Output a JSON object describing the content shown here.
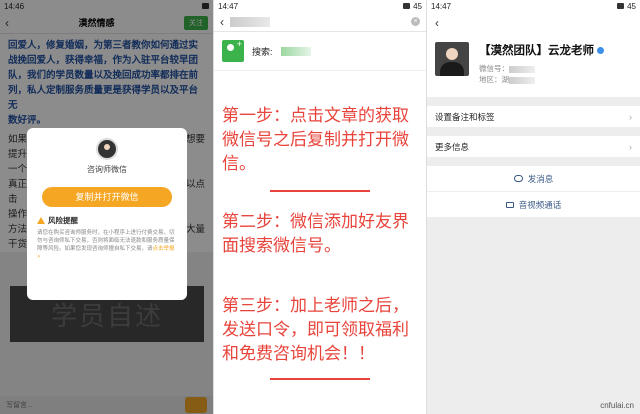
{
  "panel1": {
    "status_time": "14:46",
    "header_title": "漠然情感",
    "follow_label": "关注",
    "article_lines_blue": [
      "回爱人，修复婚姻，为第三者教你如何通过实",
      "战挽回爱人，获得幸福，作为入驻平台较早团",
      "队，我们的学员数量以及挽回成功率都排在前",
      "列，私人定制服务质量更是获得学员以及平台无",
      "数好评。"
    ],
    "article_lines_black": [
      "如果",
      "想要",
      "提升",
      "一个",
      "真正",
      "以点",
      "击",
      "操作",
      "方法",
      "大量",
      "干货"
    ],
    "modal": {
      "name": "咨询师微信",
      "copy_button": "复制并打开微信",
      "risk_title": "风险提醒",
      "risk_text": "请您在购买咨询师服务时，在小程序上进行付费交易，切勿与咨询师私下交易，否则将面临无法退款和服务质量保障等风险。如果您发现咨询师擅自私下交易，请",
      "risk_link": "点击举报 >"
    },
    "banner_text": "学员自述",
    "bottom_placeholder": "写留言..."
  },
  "panel2": {
    "status_time": "14:47",
    "status_battery": "45",
    "search_label": "搜索:",
    "step1": "第一步：点击文章的获取微信号之后复制并打开微信。",
    "step2": "第二步：微信添加好友界面搜索微信号。",
    "step3": "第三步：加上老师之后，发送口令，即可领取福利和免费咨询机会！！"
  },
  "panel3": {
    "status_time": "14:47",
    "status_battery": "45",
    "profile_name": "【漠然团队】云龙老师",
    "wechat_id_label": "微信号：",
    "region_label": "地区：湖",
    "row_remarks": "设置备注和标签",
    "row_more": "更多信息",
    "action_message": "发消息",
    "action_video": "音视频通话"
  },
  "watermark": "cnfulai.cn",
  "colors": {
    "wechat_green": "#3cb34a",
    "step_red": "#e8443b",
    "accent_orange": "#f5a623",
    "link_blue": "#3b5a86"
  }
}
